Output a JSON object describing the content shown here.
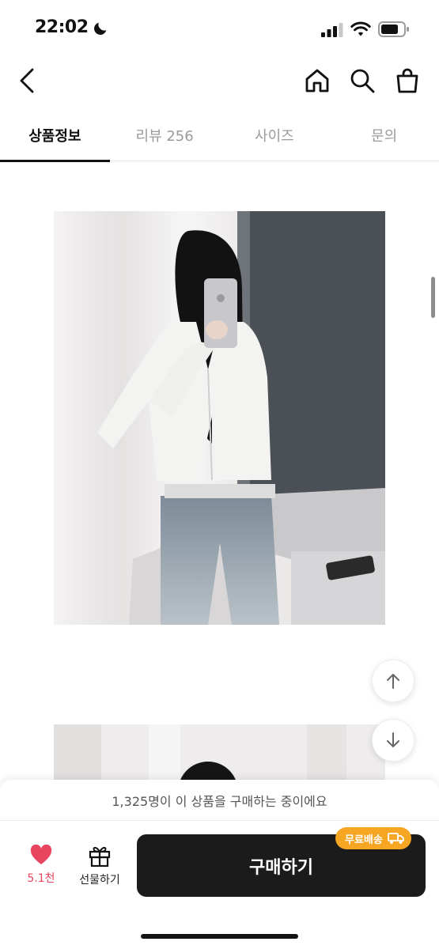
{
  "status_bar": {
    "time": "22:02"
  },
  "nav": {
    "back_icon": "chevron-left-icon",
    "home_icon": "home-icon",
    "search_icon": "search-icon",
    "bag_icon": "shopping-bag-icon"
  },
  "tabs": [
    {
      "label": "상품정보",
      "active": true
    },
    {
      "label": "리뷰 256",
      "active": false
    },
    {
      "label": "사이즈",
      "active": false
    },
    {
      "label": "문의",
      "active": false
    }
  ],
  "floating": {
    "up_icon": "arrow-up-icon",
    "down_icon": "arrow-down-icon"
  },
  "bottom": {
    "buying_notice": "1,325명이 이 상품을 구매하는 중이에요",
    "like_count": "5.1천",
    "gift_label": "선물하기",
    "buy_label": "구매하기",
    "free_shipping_label": "무료배송"
  },
  "colors": {
    "accent_like": "#e8455f",
    "buy_button": "#1b1b1b",
    "free_shipping_badge": "#f6a623"
  }
}
